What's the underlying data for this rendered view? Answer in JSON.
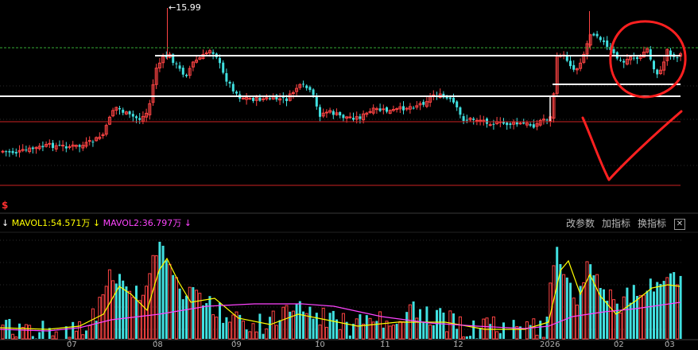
{
  "chart_data": [
    {
      "type": "candlestick",
      "peak_label": "15.99",
      "colors": {
        "up": "#ff4444",
        "down": "#40e0e0",
        "annotation": "#ff2020",
        "level": "#ffffff",
        "grid": "#2a2a2a"
      }
    },
    {
      "type": "bar",
      "title": "",
      "ma_series": [
        {
          "name": "MAVOL1",
          "value": "54.571万",
          "color": "#ffff00"
        },
        {
          "name": "MAVOL2",
          "value": "36.797万",
          "color": "#ff44ff"
        }
      ],
      "x_tick_labels": [
        "07",
        "08",
        "09",
        "10",
        "11",
        "12",
        "2026",
        "02",
        "03"
      ]
    }
  ],
  "toolbar": {
    "change_params": "改参数",
    "add_indicator": "加指标",
    "switch_indicator": "换指标",
    "close": "✕"
  },
  "markers": {
    "dollar": "$",
    "arrow_down": "↓"
  }
}
